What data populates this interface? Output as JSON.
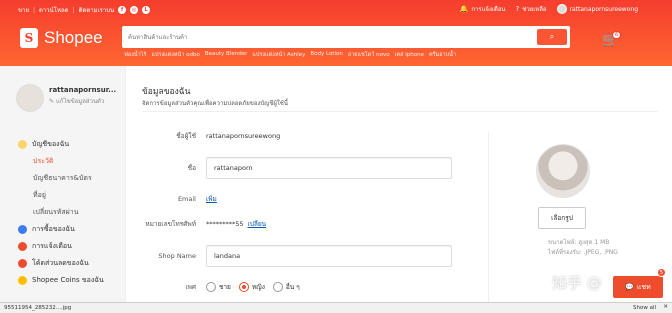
{
  "topnav": {
    "seller": "ขาย",
    "download": "ดาวน์โหลด",
    "follow": "ติดตามเราบน",
    "notifications": "การแจ้งเตือน",
    "help": "ช่วยเหลือ",
    "username": "rattanapornsureewong"
  },
  "header": {
    "brand": "Shopee",
    "search_placeholder": "ค้นหาสินค้าและร้านค้า",
    "cart_count": "6",
    "suggestions": [
      "ฟองน้ำไร้",
      "แปรงแต่งหน้า odbo",
      "Beauty Blender",
      "แปรงแต่งหน้า Ashley",
      "Body Lotion",
      "อายแชโดว์ novo",
      "เคส iphone",
      "ครีมอาบน้ำ"
    ]
  },
  "sidebar": {
    "name": "rattanapornsur...",
    "edit": "แก้ไขข้อมูลส่วนตัว",
    "my_account": "บัญชีของฉัน",
    "sub_items": [
      "ประวัติ",
      "บัญชีธนาคาร&บัตร",
      "ที่อยู่",
      "เปลี่ยนรหัสผ่าน"
    ],
    "orders": "การซื้อของฉัน",
    "notifications": "การแจ้งเตือน",
    "vouchers": "โค้ดส่วนลดของฉัน",
    "coins": "Shopee Coins ของฉัน"
  },
  "main": {
    "title": "ข้อมูลของฉัน",
    "subtitle": "จัดการข้อมูลส่วนตัวคุณเพื่อความปลอดภัยของบัญชีผู้ใช้นี้",
    "username_label": "ชื่อผู้ใช้",
    "username_value": "rattanapornsureewong",
    "name_label": "ชื่อ",
    "name_value": "rattanaporn",
    "email_label": "Email",
    "email_add": "เพิ่ม",
    "phone_label": "หมายเลขโทรศัพท์",
    "phone_value": "*********55",
    "phone_change": "เปลี่ยน",
    "shop_label": "Shop Name",
    "shop_value": "landana",
    "gender_label": "เพศ",
    "gender_options": [
      "ชาย",
      "หญิง",
      "อื่น ๆ"
    ],
    "gender_selected": "หญิง",
    "pick_image": "เลือกรูป",
    "file_size": "ขนาดไฟล์: สูงสุด 1 MB",
    "file_ext": "ไฟล์ที่รองรับ: .JPEG, .PNG"
  },
  "overlay": {
    "watermark": "知乎 @",
    "chat": "แชท",
    "chat_badge": "5"
  },
  "download_bar": {
    "file": "95511954_285232....jpg",
    "show_all": "Show all",
    "close": "✕"
  },
  "colors": {
    "primary": "#ee4d2d",
    "link": "#0055aa"
  }
}
